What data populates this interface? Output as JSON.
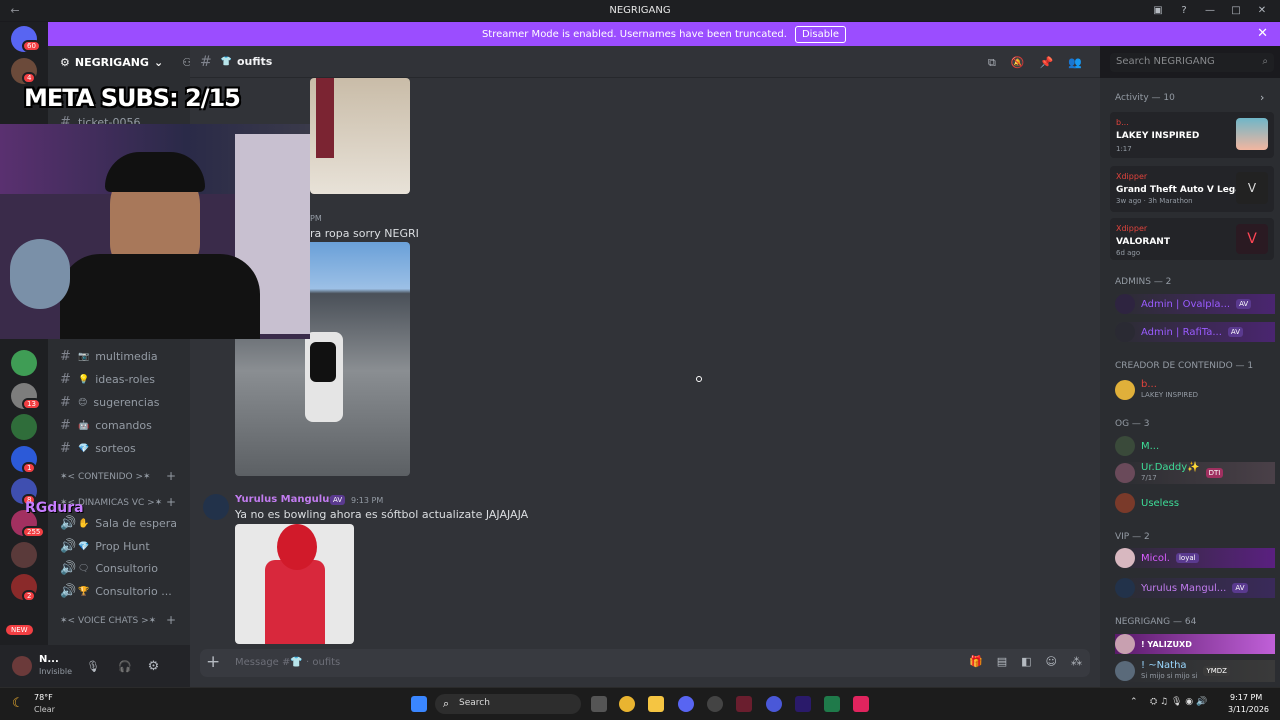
{
  "titlebar": {
    "title": "NEGRIGANG"
  },
  "banner": {
    "text": "Streamer Mode is enabled. Usernames have been truncated.",
    "disable": "Disable"
  },
  "guilds": {
    "badges": [
      "60",
      "4",
      "13",
      "1",
      "8",
      "255",
      "2"
    ],
    "new_label": "NEW"
  },
  "server": {
    "name": "NEGRIGANG"
  },
  "channels": {
    "text_partial": "ticket-0056",
    "items": [
      {
        "name": "multimedia",
        "emoji": "📷"
      },
      {
        "name": "ideas-roles",
        "emoji": "💡"
      },
      {
        "name": "sugerencias",
        "emoji": "😊"
      },
      {
        "name": "comandos",
        "emoji": "🤖"
      },
      {
        "name": "sorteos",
        "emoji": "💎"
      }
    ],
    "cat_contenido": "✶< CONTENIDO >✶",
    "cat_dinamicas": "✶< DINAMICAS VC >✶",
    "voice": [
      {
        "name": "Sala de espera",
        "emoji": "✋"
      },
      {
        "name": "Prop Hunt",
        "emoji": "💎"
      },
      {
        "name": "Consultorio",
        "emoji": "🗨"
      },
      {
        "name": "Consultorio ...",
        "emoji": "🏆"
      }
    ],
    "cat_voice": "✶< VOICE CHATS >✶"
  },
  "user": {
    "name": "N...",
    "status": "Invisible"
  },
  "channel_header": {
    "name": "oufits",
    "emoji": "👕"
  },
  "header_search": {
    "placeholder": "Search NEGRIGANG"
  },
  "messages": {
    "partial_time": "PM",
    "partial_text": "ra ropa sorry NEGRI",
    "author": "Yurulus Mangulus",
    "author_tag": "AV",
    "time": "9:13 PM",
    "text": "Ya no es bowling ahora es sóftbol actualizate JAJAJAJA"
  },
  "composer": {
    "placeholder": "Message #👕 · oufits"
  },
  "overlay": {
    "subs": "META SUBS: 2/15",
    "chat_user": "RGdura"
  },
  "activity": {
    "header": "Activity — 10",
    "cards": [
      {
        "user": "b...",
        "title": "LAKEY INSPIRED",
        "sub": "1:17"
      },
      {
        "user": "Xdipper",
        "title": "Grand Theft Auto V Legacy",
        "sub": "3w ago · 3h Marathon"
      },
      {
        "user": "Xdipper",
        "title": "VALORANT",
        "sub": "6d ago"
      }
    ]
  },
  "members": {
    "admins_header": "ADMINS — 2",
    "admins": [
      {
        "name": "Admin | Ovalpla...",
        "tag": "AV"
      },
      {
        "name": "Admin | RafiTa...",
        "tag": "AV"
      }
    ],
    "creator_header": "CREADOR DE CONTENIDO — 1",
    "creator": {
      "name": "b...",
      "sub": "LAKEY INSPIRED"
    },
    "og_header": "OG — 3",
    "og": [
      {
        "name": "M...",
        "tag": ""
      },
      {
        "name": "Ur.Daddy✨",
        "tag": "DTI",
        "sub": "7/17"
      },
      {
        "name": "Useless",
        "tag": ""
      }
    ],
    "vip_header": "VIP — 2",
    "vip": [
      {
        "name": "Micol.",
        "tag": "loyal"
      },
      {
        "name": "Yurulus Mangul...",
        "tag": "AV"
      }
    ],
    "negrigang_header": "NEGRIGANG — 64",
    "negrigang": [
      {
        "name": "! YALIZUXD",
        "tag": ""
      },
      {
        "name": "! ~Natha",
        "tag": "YMDZ",
        "sub": "Si mijo si mijo si"
      }
    ]
  },
  "taskbar": {
    "weather_temp": "78°F",
    "weather_desc": "Clear",
    "search": "Search",
    "time": "9:17 PM",
    "date": "3/11/2026"
  }
}
